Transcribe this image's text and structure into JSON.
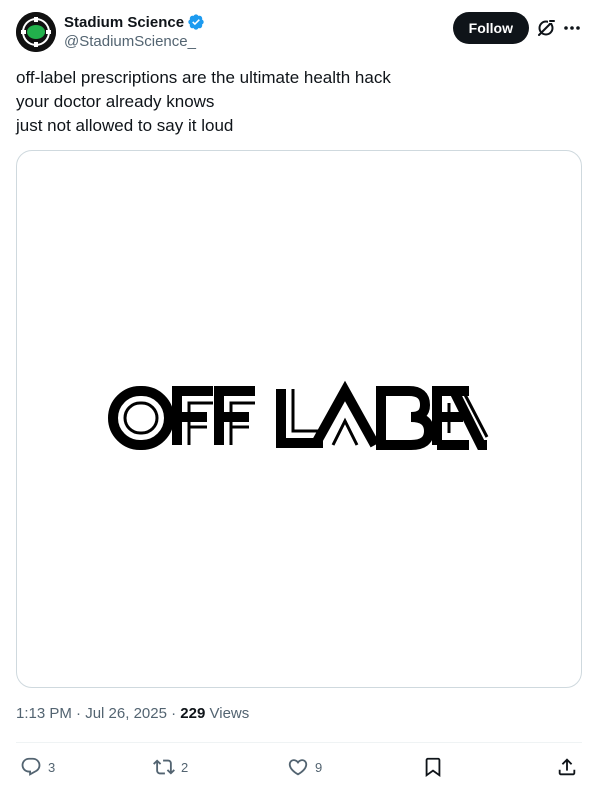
{
  "author": {
    "display_name": "Stadium Science",
    "handle": "@StadiumScience_",
    "verified": true,
    "avatar_icon": "stadium-logo-icon",
    "accent_color": "#1d9bf0"
  },
  "header": {
    "follow_label": "Follow",
    "grok_icon": "grok-icon",
    "more_icon": "more-dots-icon"
  },
  "tweet": {
    "lines": [
      "off-label prescriptions are the ultimate health hack",
      "your doctor already knows",
      "just not allowed to say it loud"
    ]
  },
  "media": {
    "image_text": "OFF LABEL",
    "background": "#ffffff"
  },
  "meta": {
    "time": "1:13 PM",
    "separator": "·",
    "date": "Jul 26, 2025",
    "views_count": "229",
    "views_label": "Views"
  },
  "actions": {
    "replies": "3",
    "reposts": "2",
    "likes": "9",
    "reply_icon": "reply-icon",
    "repost_icon": "repost-icon",
    "like_icon": "heart-icon",
    "bookmark_icon": "bookmark-icon",
    "share_icon": "share-icon"
  }
}
